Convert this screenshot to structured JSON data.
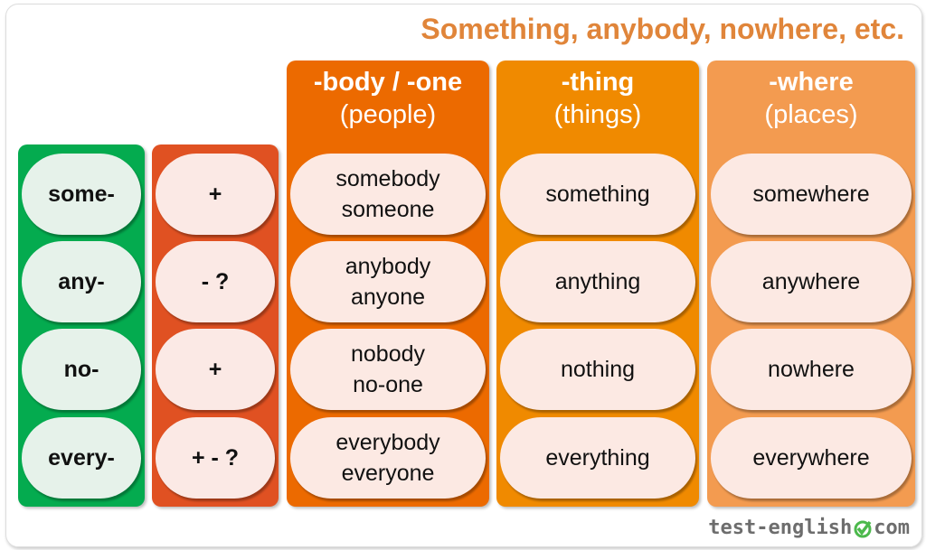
{
  "title": "Something, anybody, nowhere, etc.",
  "colors": {
    "prefix": "#04ab4f",
    "sign": "#e05122",
    "body": "#ec6a00",
    "thing": "#f08a00",
    "where": "#f39b50",
    "title": "#e0853a"
  },
  "prefixes": [
    "some-",
    "any-",
    "no-",
    "every-"
  ],
  "signs": [
    "+",
    "- ?",
    "+",
    "+ - ?"
  ],
  "columns": [
    {
      "head": "-body / -one",
      "sub": "(people)",
      "rows": [
        [
          "somebody",
          "someone"
        ],
        [
          "anybody",
          "anyone"
        ],
        [
          "nobody",
          "no-one"
        ],
        [
          "everybody",
          "everyone"
        ]
      ]
    },
    {
      "head": "-thing",
      "sub": "(things)",
      "rows": [
        [
          "something"
        ],
        [
          "anything"
        ],
        [
          "nothing"
        ],
        [
          "everything"
        ]
      ]
    },
    {
      "head": "-where",
      "sub": "(places)",
      "rows": [
        [
          "somewhere"
        ],
        [
          "anywhere"
        ],
        [
          "nowhere"
        ],
        [
          "everywhere"
        ]
      ]
    }
  ],
  "logo": {
    "left": "test-english",
    "right": "com",
    "icon": "check-circle-icon"
  }
}
